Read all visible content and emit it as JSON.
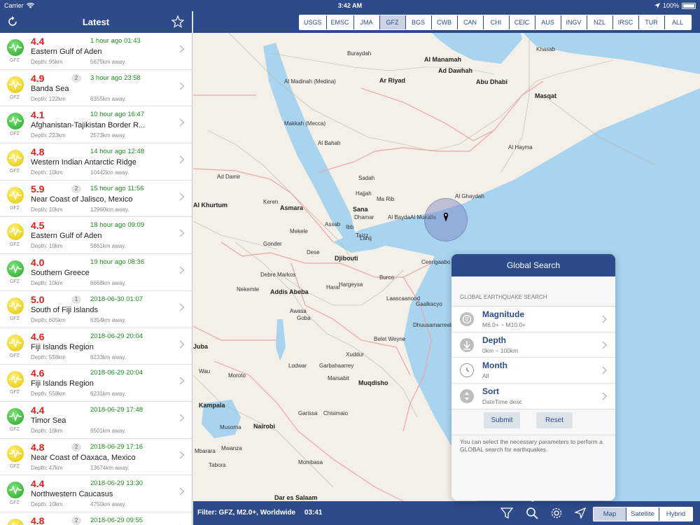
{
  "status": {
    "carrier": "Carrier",
    "time": "3:42 AM",
    "battery": "100%"
  },
  "sidebar": {
    "title": "Latest",
    "items": [
      {
        "mag": "4.4",
        "color": "green",
        "count": "",
        "time": "1 hour ago 01:43",
        "place": "Eastern Gulf of Aden",
        "depth": "Depth: 95km",
        "distance": "5675km away.",
        "source": "GFZ"
      },
      {
        "mag": "4.9",
        "color": "yellow",
        "count": "2",
        "time": "3 hour ago 23:58",
        "place": "Banda Sea",
        "depth": "Depth: 122km",
        "distance": "6355km away.",
        "source": "GFZ"
      },
      {
        "mag": "4.1",
        "color": "green",
        "count": "",
        "time": "10 hour ago 16:47",
        "place": "Afghanistan-Tajikistan Border R...",
        "depth": "Depth: 223km",
        "distance": "2573km away.",
        "source": "GFZ"
      },
      {
        "mag": "4.8",
        "color": "yellow",
        "count": "",
        "time": "14 hour ago 12:48",
        "place": "Western Indian Antarctic Ridge",
        "depth": "Depth: 10km",
        "distance": "10442km away.",
        "source": "GFZ"
      },
      {
        "mag": "5.9",
        "color": "yellow",
        "count": "2",
        "time": "15 hour ago 11:56",
        "place": "Near Coast of Jalisco, Mexico",
        "depth": "Depth: 10km",
        "distance": "12960km away.",
        "source": "GFZ"
      },
      {
        "mag": "4.5",
        "color": "yellow",
        "count": "",
        "time": "18 hour ago 09:09",
        "place": "Eastern Gulf of Aden",
        "depth": "Depth: 10km",
        "distance": "5661km away.",
        "source": "GFZ"
      },
      {
        "mag": "4.0",
        "color": "green",
        "count": "",
        "time": "19 hour ago 08:36",
        "place": "Southern Greece",
        "depth": "Depth: 10km",
        "distance": "6668km away.",
        "source": "GFZ"
      },
      {
        "mag": "5.0",
        "color": "yellow",
        "count": "1",
        "time": "2018-06-30 01:07",
        "place": "South of Fiji Islands",
        "depth": "Depth: 605km",
        "distance": "6354km away.",
        "source": "GFZ"
      },
      {
        "mag": "4.6",
        "color": "yellow",
        "count": "",
        "time": "2018-06-29 20:04",
        "place": "Fiji Islands Region",
        "depth": "Depth: 558km",
        "distance": "6233km away.",
        "source": "GFZ"
      },
      {
        "mag": "4.6",
        "color": "yellow",
        "count": "",
        "time": "2018-06-29 20:04",
        "place": "Fiji Islands Region",
        "depth": "Depth: 558km",
        "distance": "6231km away.",
        "source": "GFZ"
      },
      {
        "mag": "4.4",
        "color": "green",
        "count": "",
        "time": "2018-06-29 17:48",
        "place": "Timor Sea",
        "depth": "Depth: 10km",
        "distance": "6501km away.",
        "source": "GFZ"
      },
      {
        "mag": "4.8",
        "color": "yellow",
        "count": "2",
        "time": "2018-06-29 17:16",
        "place": "Near Coast of Oaxaca, Mexico",
        "depth": "Depth: 47km",
        "distance": "13674km away.",
        "source": "GFZ"
      },
      {
        "mag": "4.4",
        "color": "green",
        "count": "",
        "time": "2018-06-29 13:30",
        "place": "Northwestern Caucasus",
        "depth": "Depth: 10km",
        "distance": "4750km away.",
        "source": "GFZ"
      },
      {
        "mag": "4.8",
        "color": "yellow",
        "count": "2",
        "time": "2018-06-29 09:55",
        "place": "",
        "depth": "",
        "distance": "",
        "source": ""
      }
    ]
  },
  "agencies": {
    "items": [
      "USGS",
      "EMSC",
      "JMA",
      "GFZ",
      "BGS",
      "CWB",
      "CAN",
      "CHI",
      "CEIC",
      "AUS",
      "INGV",
      "NZL",
      "IRSC",
      "TUR",
      "ALL"
    ],
    "selected": "GFZ"
  },
  "map": {
    "labels": [
      {
        "t": "Al Manamah",
        "c": "major"
      },
      {
        "t": "Ad Dawhah",
        "c": "major"
      },
      {
        "t": "Ar Riyad",
        "c": "major"
      },
      {
        "t": "Abu Dhabi",
        "c": "major"
      },
      {
        "t": "Masqat",
        "c": "major"
      },
      {
        "t": "Buraydah",
        "c": ""
      },
      {
        "t": "Al Madinah (Medina)",
        "c": ""
      },
      {
        "t": "Makkah (Mecca)",
        "c": ""
      },
      {
        "t": "Al Bahah",
        "c": ""
      },
      {
        "t": "Ad Damir",
        "c": ""
      },
      {
        "t": "Sadah",
        "c": ""
      },
      {
        "t": "Hajjah",
        "c": ""
      },
      {
        "t": "Sana",
        "c": "major"
      },
      {
        "t": "Ma Rib",
        "c": ""
      },
      {
        "t": "Dhamar",
        "c": ""
      },
      {
        "t": "Al Bayda",
        "c": ""
      },
      {
        "t": "Al Mukalla",
        "c": ""
      },
      {
        "t": "Ibb",
        "c": ""
      },
      {
        "t": "Taizz",
        "c": ""
      },
      {
        "t": "Lahij",
        "c": ""
      },
      {
        "t": "Al Ghaydah",
        "c": ""
      },
      {
        "t": "Al Hayma",
        "c": ""
      },
      {
        "t": "Khasab",
        "c": ""
      },
      {
        "t": "Al Khurtum",
        "c": "major"
      },
      {
        "t": "Asmara",
        "c": "major"
      },
      {
        "t": "Keren",
        "c": ""
      },
      {
        "t": "Assab",
        "c": ""
      },
      {
        "t": "Mekele",
        "c": ""
      },
      {
        "t": "Gonder",
        "c": ""
      },
      {
        "t": "Djibouti",
        "c": "major"
      },
      {
        "t": "Dese",
        "c": ""
      },
      {
        "t": "Debre Markos",
        "c": ""
      },
      {
        "t": "Addis Abeba",
        "c": "major"
      },
      {
        "t": "Nekemte",
        "c": ""
      },
      {
        "t": "Harar",
        "c": ""
      },
      {
        "t": "Hargeysa",
        "c": ""
      },
      {
        "t": "Awasa",
        "c": ""
      },
      {
        "t": "Goba",
        "c": ""
      },
      {
        "t": "Burco",
        "c": ""
      },
      {
        "t": "Laascaanood",
        "c": ""
      },
      {
        "t": "Ceerigaabo",
        "c": ""
      },
      {
        "t": "Gaalkacyo",
        "c": ""
      },
      {
        "t": "Dhuusamarreeb",
        "c": ""
      },
      {
        "t": "Belet Weyne",
        "c": ""
      },
      {
        "t": "Xuddur",
        "c": ""
      },
      {
        "t": "Garbahaarrey",
        "c": ""
      },
      {
        "t": "Muqdisho",
        "c": "major"
      },
      {
        "t": "Moroto",
        "c": ""
      },
      {
        "t": "Lodwar",
        "c": ""
      },
      {
        "t": "Marsabit",
        "c": ""
      },
      {
        "t": "Kampala",
        "c": "major"
      },
      {
        "t": "Musoma",
        "c": ""
      },
      {
        "t": "Nairobi",
        "c": "major"
      },
      {
        "t": "Garissa",
        "c": ""
      },
      {
        "t": "Chisimaio",
        "c": ""
      },
      {
        "t": "Mwanza",
        "c": ""
      },
      {
        "t": "Mombasa",
        "c": ""
      },
      {
        "t": "Dar es Salaam",
        "c": "major"
      },
      {
        "t": "Juba",
        "c": "major"
      },
      {
        "t": "Wau",
        "c": ""
      },
      {
        "t": "Mbarara",
        "c": ""
      },
      {
        "t": "Tabora",
        "c": ""
      }
    ]
  },
  "search": {
    "title": "Global Search",
    "section": "GLOBAL EARTHQUAKE SEARCH",
    "rows": [
      {
        "label": "Magnitude",
        "value": "M6.0+ ~ M10.0+"
      },
      {
        "label": "Depth",
        "value": "0km ~ 100km"
      },
      {
        "label": "Month",
        "value": "All"
      },
      {
        "label": "Sort",
        "value": "DateTime desc"
      }
    ],
    "submit": "Submit",
    "reset": "Reset",
    "help": "You can select the necessary parameters to perform a GLOBAL search for earthquakes."
  },
  "bottombar": {
    "filter": "Filter: GFZ, M2.0+, Worldwide",
    "time": "03:41",
    "map_types": [
      "Map",
      "Satellite",
      "Hybrid"
    ],
    "selected_type": "Map"
  },
  "colors": {
    "brand": "#2d4b8a",
    "water": "#a8d4f0",
    "land": "#f4f0e7",
    "magnitude": "#e21d1d",
    "time": "#1c8a1c"
  },
  "icons": [
    "refresh-icon",
    "star-icon",
    "chevron-right-icon",
    "filter-icon",
    "search-icon",
    "gear-icon",
    "location-arrow-icon",
    "map-pin-icon"
  ]
}
